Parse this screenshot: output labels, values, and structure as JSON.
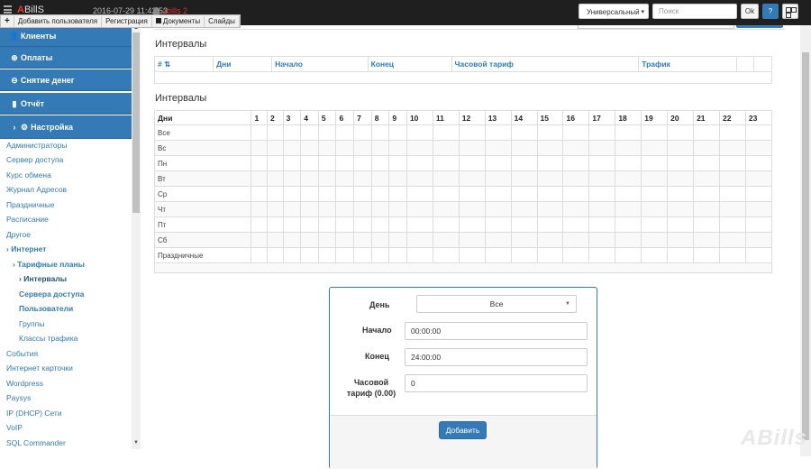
{
  "header": {
    "logo_prefix": "A",
    "logo_rest": "BillS",
    "datetime": "2016-07-29 11:42:53",
    "user": "abills 2",
    "search_type": "Универсальный",
    "search_placeholder": "Поиск",
    "ok_label": "Ok",
    "help_label": "?"
  },
  "quickbar": {
    "plus": "+",
    "items": [
      "Добавить пользователя",
      "Регистрация",
      "Документы",
      "Слайды"
    ]
  },
  "sidebar": {
    "main_items": [
      {
        "label": "Клиенты",
        "icon": "user-icon",
        "glyph": "👤"
      },
      {
        "label": "Оплаты",
        "icon": "plus-circle-icon",
        "glyph": "⊕"
      },
      {
        "label": "Снятие денег",
        "icon": "minus-circle-icon",
        "glyph": "⊖"
      },
      {
        "label": "Отчёт",
        "icon": "bar-chart-icon",
        "glyph": "▮"
      },
      {
        "label": "Настройка",
        "icon": "gear-icon",
        "glyph": "›"
      }
    ],
    "settings_icon_glyph": "⚙",
    "sub_items": [
      "Администраторы",
      "Сервер доступа",
      "Курс обмена",
      "Журнал Адресов",
      "Праздничные",
      "Расписание",
      "Другое",
      "Интернет",
      "Тарифные планы",
      "Интервалы",
      "Сервера доступа",
      "Пользователи",
      "Группы",
      "Классы трафика",
      "События",
      "Интернет карточки",
      "Wordpress",
      "Paysys",
      "IP (DHCP) Сети",
      "VoIP",
      "SQL Commander"
    ]
  },
  "section1": {
    "title": "Интервалы",
    "columns": [
      "#",
      "Дни",
      "Начало",
      "Конец",
      "Часовой тариф",
      "Трафик",
      "",
      ""
    ]
  },
  "section2": {
    "title": "Интервалы",
    "header_first": "Дни",
    "hours": [
      "1",
      "2",
      "3",
      "4",
      "5",
      "6",
      "7",
      "8",
      "9",
      "10",
      "11",
      "12",
      "13",
      "14",
      "15",
      "16",
      "17",
      "18",
      "19",
      "20",
      "21",
      "22",
      "23"
    ],
    "days": [
      "Все",
      "Вс",
      "Пн",
      "Вт",
      "Ср",
      "Чт",
      "Пт",
      "Сб",
      "Праздничные"
    ]
  },
  "form": {
    "day_label": "День",
    "day_value": "Все",
    "start_label": "Начало",
    "start_value": "00:00:00",
    "end_label": "Конец",
    "end_value": "24:00:00",
    "tariff_label_1": "Часовой",
    "tariff_label_2": "тариф (0.00)",
    "tariff_value": "0",
    "submit_label": "Добавить"
  },
  "watermark": "ABills",
  "colors": {
    "primary": "#337ab7",
    "topbar": "#1f1f1f",
    "logo_accent": "#ee3333"
  }
}
